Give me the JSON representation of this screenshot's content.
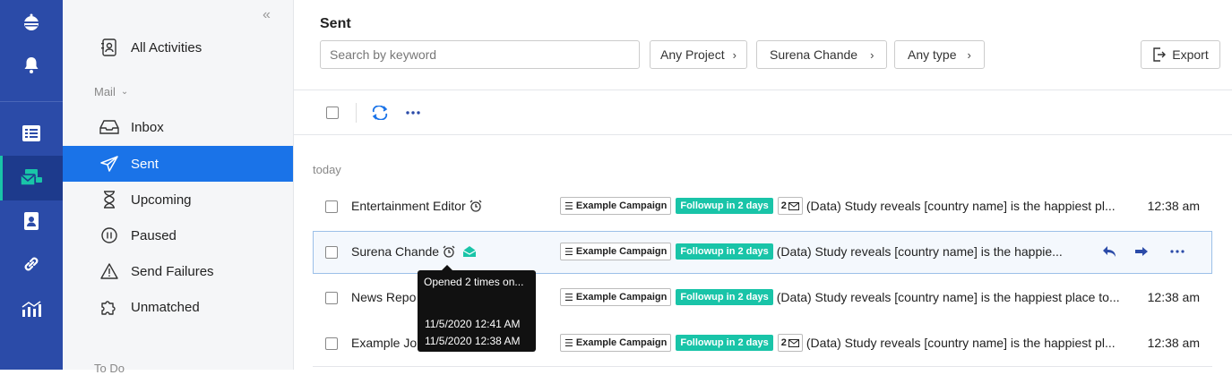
{
  "rail": {
    "icons": [
      "logo-icon",
      "bell-icon",
      "list-icon",
      "mail-stack-icon",
      "contact-icon",
      "link-icon",
      "analytics-icon"
    ]
  },
  "sidebar": {
    "all_activities": "All Activities",
    "mail_section": "Mail",
    "items": [
      {
        "label": "Inbox",
        "icon": "inbox-icon"
      },
      {
        "label": "Sent",
        "icon": "paper-plane-icon"
      },
      {
        "label": "Upcoming",
        "icon": "hourglass-icon"
      },
      {
        "label": "Paused",
        "icon": "pause-circle-icon"
      },
      {
        "label": "Send Failures",
        "icon": "warning-icon"
      },
      {
        "label": "Unmatched",
        "icon": "puzzle-icon"
      }
    ],
    "todo_section": "To Do"
  },
  "header": {
    "title": "Sent",
    "search_placeholder": "Search by keyword",
    "filters": [
      "Any Project",
      "Surena Chande",
      "Any type"
    ],
    "export_label": "Export"
  },
  "list": {
    "group": "today",
    "rows": [
      {
        "name": "Entertainment Editor",
        "campaign": "Example Campaign",
        "followup": "Followup in 2 days",
        "count": "2",
        "subject": "(Data) Study reveals [country name] is the happiest pl...",
        "time": "12:38 am"
      },
      {
        "name": "Surena Chande",
        "campaign": "Example Campaign",
        "followup": "Followup in 2 days",
        "subject": "(Data) Study reveals [country name] is the happie...",
        "time": ""
      },
      {
        "name": "News Repo",
        "campaign": "Example Campaign",
        "followup": "Followup in 2 days",
        "subject": "(Data) Study reveals [country name] is the happiest place to...",
        "time": "12:38 am"
      },
      {
        "name": "Example Jo",
        "campaign": "Example Campaign",
        "followup": "Followup in 2 days",
        "count": "2",
        "subject": "(Data) Study reveals [country name] is the happiest pl...",
        "time": "12:38 am"
      }
    ]
  },
  "tooltip": {
    "line1": "Opened 2 times on...",
    "line2": "11/5/2020 12:41 AM",
    "line3": "11/5/2020 12:38 AM"
  },
  "colors": {
    "rail": "#2b4ba8",
    "accent": "#1a73e8",
    "teal": "#19c4a8"
  }
}
